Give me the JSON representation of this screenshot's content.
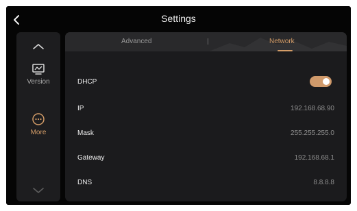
{
  "header": {
    "title": "Settings",
    "back_icon": "chevron-left-icon"
  },
  "sidebar": {
    "up_icon": "chevron-up-icon",
    "down_icon": "chevron-down-icon",
    "items": [
      {
        "label": "Version",
        "icon": "monitor-icon",
        "active": false
      },
      {
        "label": "More",
        "icon": "more-dots-icon",
        "active": true
      }
    ]
  },
  "tabs": [
    {
      "label": "Advanced",
      "active": false
    },
    {
      "label": "Network",
      "active": true
    }
  ],
  "network": {
    "dhcp": {
      "label": "DHCP",
      "enabled": true
    },
    "rows": [
      {
        "label": "IP",
        "value": "192.168.68.90"
      },
      {
        "label": "Mask",
        "value": "255.255.255.0"
      },
      {
        "label": "Gateway",
        "value": "192.168.68.1"
      },
      {
        "label": "DNS",
        "value": "8.8.8.8"
      }
    ]
  },
  "colors": {
    "accent": "#d49d68",
    "background": "#050505",
    "panel": "#1b1b1d",
    "sidebar": "#1d1d1f"
  }
}
